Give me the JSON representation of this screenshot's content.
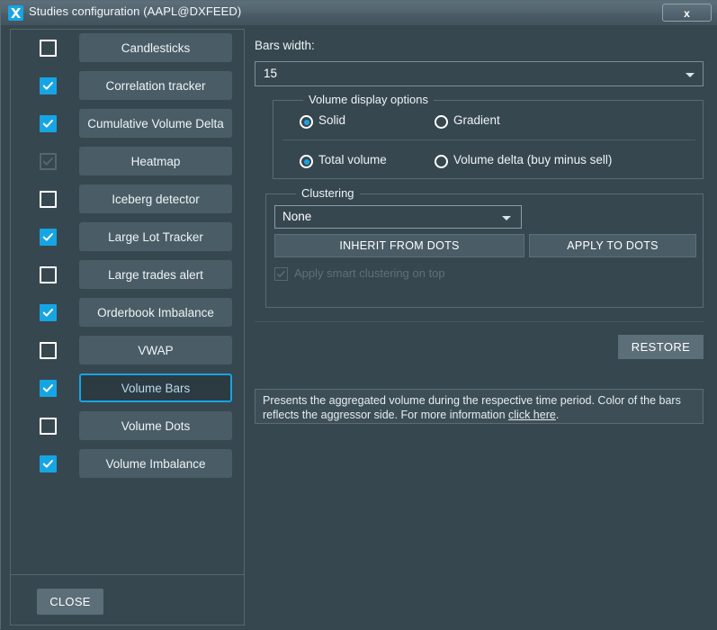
{
  "window": {
    "title": "Studies configuration (AAPL@DXFEED)",
    "app_icon": "x-logo-icon",
    "close_label": "x"
  },
  "sidebar": {
    "items": [
      {
        "label": "Candlesticks",
        "checked": false,
        "disabled": false,
        "selected": false
      },
      {
        "label": "Correlation tracker",
        "checked": true,
        "disabled": false,
        "selected": false
      },
      {
        "label": "Cumulative Volume Delta",
        "checked": true,
        "disabled": false,
        "selected": false
      },
      {
        "label": "Heatmap",
        "checked": true,
        "disabled": true,
        "selected": false
      },
      {
        "label": "Iceberg detector",
        "checked": false,
        "disabled": false,
        "selected": false
      },
      {
        "label": "Large Lot Tracker",
        "checked": true,
        "disabled": false,
        "selected": false
      },
      {
        "label": "Large trades alert",
        "checked": false,
        "disabled": false,
        "selected": false
      },
      {
        "label": "Orderbook Imbalance",
        "checked": true,
        "disabled": false,
        "selected": false
      },
      {
        "label": "VWAP",
        "checked": false,
        "disabled": false,
        "selected": false
      },
      {
        "label": "Volume Bars",
        "checked": true,
        "disabled": false,
        "selected": true
      },
      {
        "label": "Volume Dots",
        "checked": false,
        "disabled": false,
        "selected": false
      },
      {
        "label": "Volume Imbalance",
        "checked": true,
        "disabled": false,
        "selected": false
      }
    ],
    "close_label": "CLOSE"
  },
  "settings": {
    "bars_width": {
      "label": "Bars width:",
      "value": "15"
    },
    "volume_display": {
      "legend": "Volume display options",
      "options": [
        {
          "label": "Solid",
          "selected": true
        },
        {
          "label": "Gradient",
          "selected": false
        },
        {
          "label": "Total volume",
          "selected": true
        },
        {
          "label": "Volume delta (buy minus sell)",
          "selected": false
        }
      ]
    },
    "clustering": {
      "legend": "Clustering",
      "value": "None",
      "inherit_label": "INHERIT FROM DOTS",
      "apply_label": "APPLY TO DOTS",
      "smart_label": "Apply smart clustering on top",
      "smart_checked": true,
      "smart_disabled": true
    },
    "restore_label": "RESTORE",
    "description": {
      "text_before": "Presents the aggregated volume during the respective time period. Color of the bars reflects the aggressor side. For more information ",
      "link_text": "click here",
      "text_after": "."
    }
  },
  "colors": {
    "window_bg": "#37474f",
    "accent": "#16a5e4",
    "button_bg": "#4a5d67",
    "selected_border": "#16a5e4",
    "selected_bg": "#2c3a42",
    "text": "#eef4f6",
    "disabled_text": "#5e7078"
  }
}
